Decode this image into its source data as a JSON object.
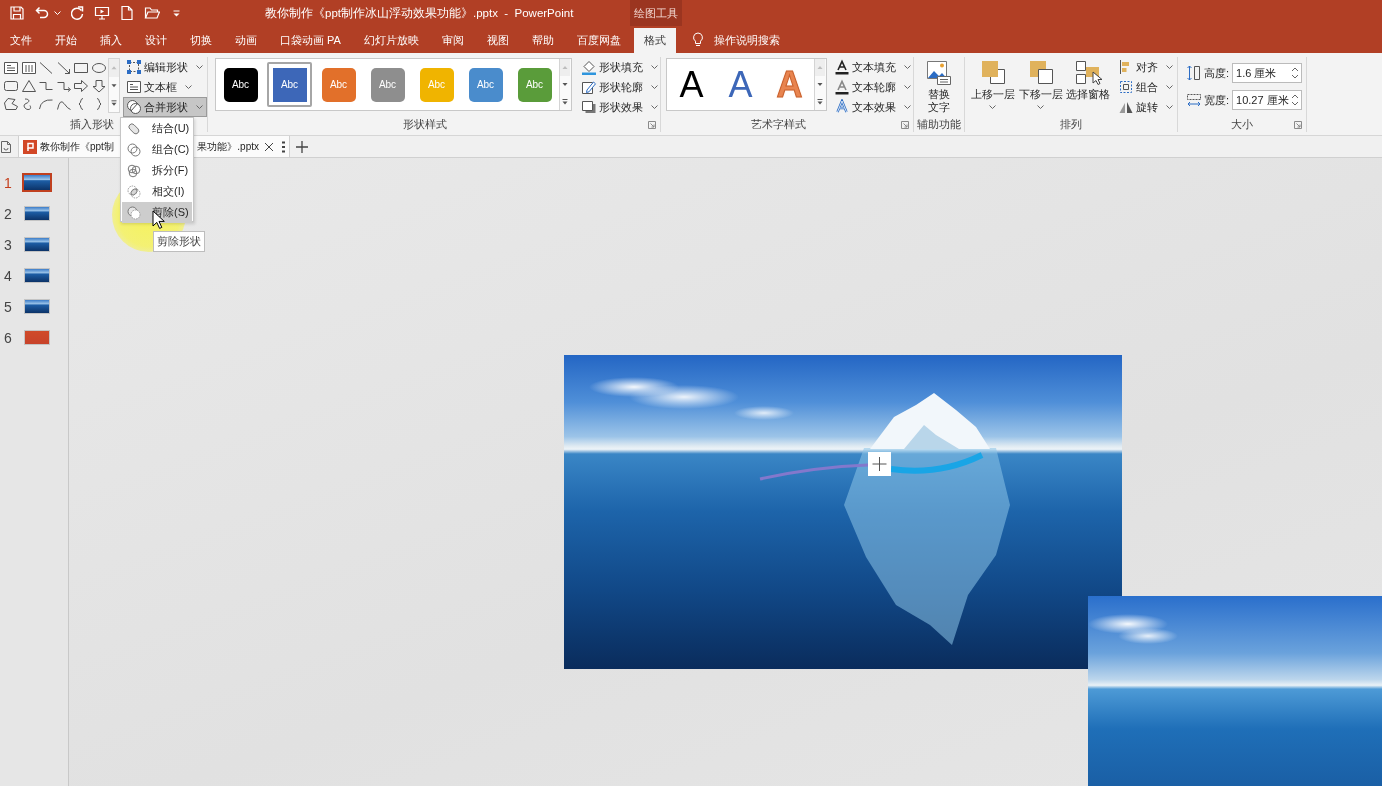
{
  "title_bar": {
    "title": "教你制作《ppt制作冰山浮动效果功能》.pptx  -  PowerPoint",
    "context_header": "绘图工具"
  },
  "ribbon_tabs": [
    {
      "label": "文件",
      "selected": false
    },
    {
      "label": "开始",
      "selected": false
    },
    {
      "label": "插入",
      "selected": false
    },
    {
      "label": "设计",
      "selected": false
    },
    {
      "label": "切换",
      "selected": false
    },
    {
      "label": "动画",
      "selected": false
    },
    {
      "label": "口袋动画 PA",
      "selected": false
    },
    {
      "label": "幻灯片放映",
      "selected": false
    },
    {
      "label": "审阅",
      "selected": false
    },
    {
      "label": "视图",
      "selected": false
    },
    {
      "label": "帮助",
      "selected": false
    },
    {
      "label": "百度网盘",
      "selected": false
    },
    {
      "label": "格式",
      "selected": true
    }
  ],
  "tell_me": {
    "label": "操作说明搜索"
  },
  "ribbon": {
    "insert_shapes": {
      "label": "插入形状",
      "commands": [
        {
          "label": "编辑形状",
          "pressed": false
        },
        {
          "label": "文本框",
          "pressed": false
        },
        {
          "label": "合并形状",
          "pressed": true
        }
      ]
    },
    "shape_styles": {
      "label": "形状样式",
      "swatches": [
        {
          "text": "Abc",
          "color": "#000000",
          "selected": false
        },
        {
          "text": "Abc",
          "color": "#3d67b8",
          "selected": true
        },
        {
          "text": "Abc",
          "color": "#e2702a",
          "selected": false
        },
        {
          "text": "Abc",
          "color": "#8e8e8e",
          "selected": false
        },
        {
          "text": "Abc",
          "color": "#f0b400",
          "selected": false
        },
        {
          "text": "Abc",
          "color": "#4a8ccc",
          "selected": false
        },
        {
          "text": "Abc",
          "color": "#5a9c3a",
          "selected": false
        }
      ],
      "commands": [
        "形状填充",
        "形状轮廓",
        "形状效果"
      ]
    },
    "wordart_styles": {
      "label": "艺术字样式",
      "samples": [
        {
          "text": "A",
          "kind": "solid",
          "color": "#000000"
        },
        {
          "text": "A",
          "kind": "solid",
          "color": "#3d67b8"
        },
        {
          "text": "A",
          "kind": "outline",
          "color": "#e8844f"
        }
      ],
      "commands": [
        "文本填充",
        "文本轮廓",
        "文本效果"
      ]
    },
    "accessibility": {
      "label": "辅助功能",
      "button": "替换文字"
    },
    "arrange": {
      "label": "排列",
      "large_buttons": [
        {
          "label": "上移一层",
          "dropdown": true
        },
        {
          "label": "下移一层",
          "dropdown": true
        },
        {
          "label": "选择窗格",
          "dropdown": false
        }
      ],
      "commands": [
        "对齐",
        "组合",
        "旋转"
      ]
    },
    "size": {
      "label": "大小",
      "fields": [
        {
          "label": "高度:",
          "value": "1.6 厘米"
        },
        {
          "label": "宽度:",
          "value": "10.27 厘米"
        }
      ]
    }
  },
  "document_tab": {
    "title_parts": [
      "教你制作《ppt制",
      "果功能》.pptx"
    ]
  },
  "slides": [
    {
      "number": "1",
      "kind": "photo",
      "selected": true
    },
    {
      "number": "2",
      "kind": "photo",
      "selected": false
    },
    {
      "number": "3",
      "kind": "photo",
      "selected": false
    },
    {
      "number": "4",
      "kind": "photo",
      "selected": false
    },
    {
      "number": "5",
      "kind": "photo",
      "selected": false
    },
    {
      "number": "6",
      "kind": "plain",
      "selected": false
    }
  ],
  "merge_menu": {
    "items": [
      {
        "label": "结合(U)",
        "hovered": false
      },
      {
        "label": "组合(C)",
        "hovered": false
      },
      {
        "label": "拆分(F)",
        "hovered": false
      },
      {
        "label": "相交(I)",
        "hovered": false
      },
      {
        "label": "剪除(S)",
        "hovered": true
      }
    ],
    "tooltip": "剪除形状"
  }
}
